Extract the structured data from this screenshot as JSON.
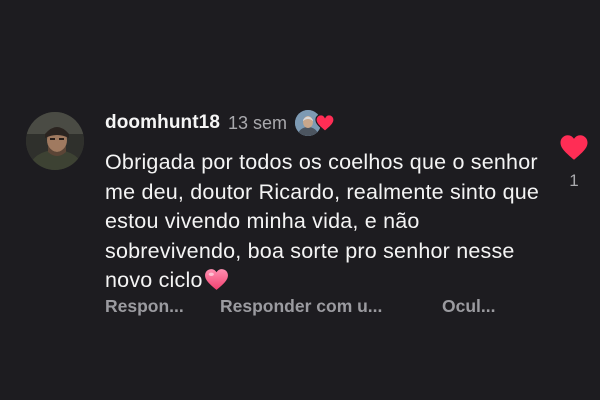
{
  "comment": {
    "username": "doomhunt18",
    "time": "13 sem",
    "text": "Obrigada por todos os coelhos que o senhor me deu, doutor Ricardo, realmente sinto que estou vivendo minha vida, e não sobrevivendo, boa sorte pro senhor nesse novo ciclo",
    "trailing_emoji": "heart-emoji",
    "actions": {
      "reply": "Respon...",
      "reply_with": "Responder com u...",
      "hide": "Ocul..."
    },
    "likes": {
      "count": "1",
      "icon": "heart-icon",
      "liked": true
    },
    "creator_like": {
      "icon": "heart-icon"
    }
  },
  "colors": {
    "background": "#1d1c20",
    "text": "#f4f4f4",
    "muted": "#a9a9ad",
    "action": "#9b9ba0",
    "like_red": "#ff2d55",
    "emoji_pink": "#ff5a86"
  }
}
